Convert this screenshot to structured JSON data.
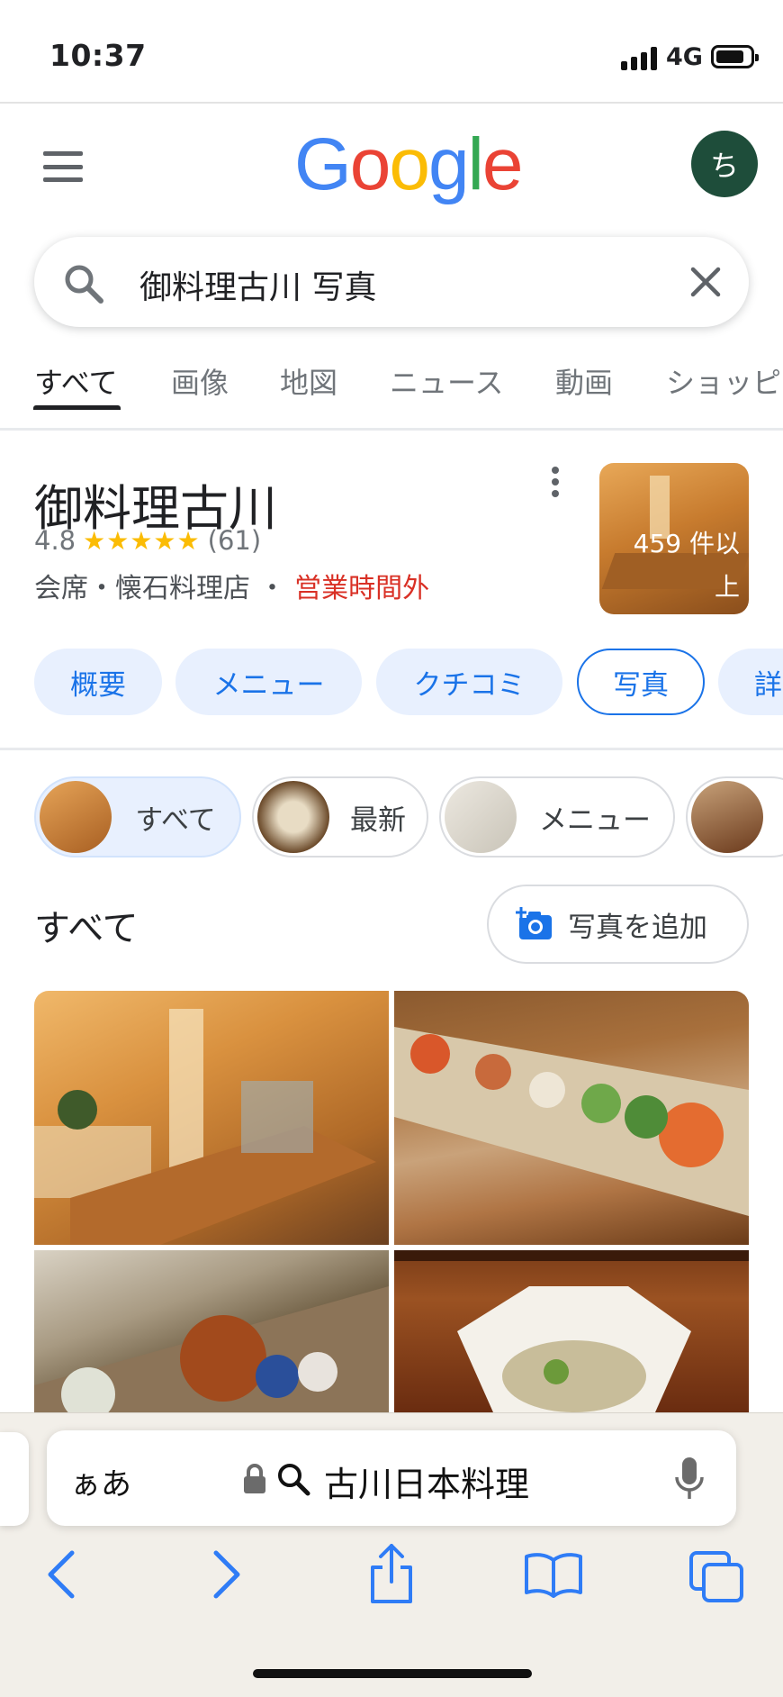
{
  "status_bar": {
    "time": "10:37",
    "network": "4G"
  },
  "header": {
    "logo": [
      "G",
      "o",
      "o",
      "g",
      "l",
      "e"
    ],
    "logo_colors": [
      "#4285f4",
      "#ea4335",
      "#fbbc05",
      "#4285f4",
      "#34a853",
      "#ea4335"
    ],
    "avatar_initial": "ち"
  },
  "search": {
    "query": "御料理古川 写真"
  },
  "tabs": [
    {
      "label": "すべて",
      "active": true
    },
    {
      "label": "画像"
    },
    {
      "label": "地図"
    },
    {
      "label": "ニュース"
    },
    {
      "label": "動画"
    },
    {
      "label": "ショッピ"
    }
  ],
  "place": {
    "name": "御料理古川",
    "rating": "4.8",
    "stars": "★★★★★",
    "review_count": "(61)",
    "category": "会席・懐石料理店",
    "separator": "・",
    "status": "営業時間外",
    "photo_count": "459 件以上"
  },
  "chips": [
    "概要",
    "メニュー",
    "クチコミ",
    "写真",
    "詳"
  ],
  "filters": [
    "すべて",
    "最新",
    "メニュー"
  ],
  "section": {
    "title": "すべて",
    "add_photo": "写真を追加"
  },
  "safari": {
    "aa": "ぁあ",
    "address": "古川日本料理"
  },
  "colors": {
    "accent": "#1a73e8",
    "closed": "#d93025",
    "star": "#fbbc04"
  }
}
